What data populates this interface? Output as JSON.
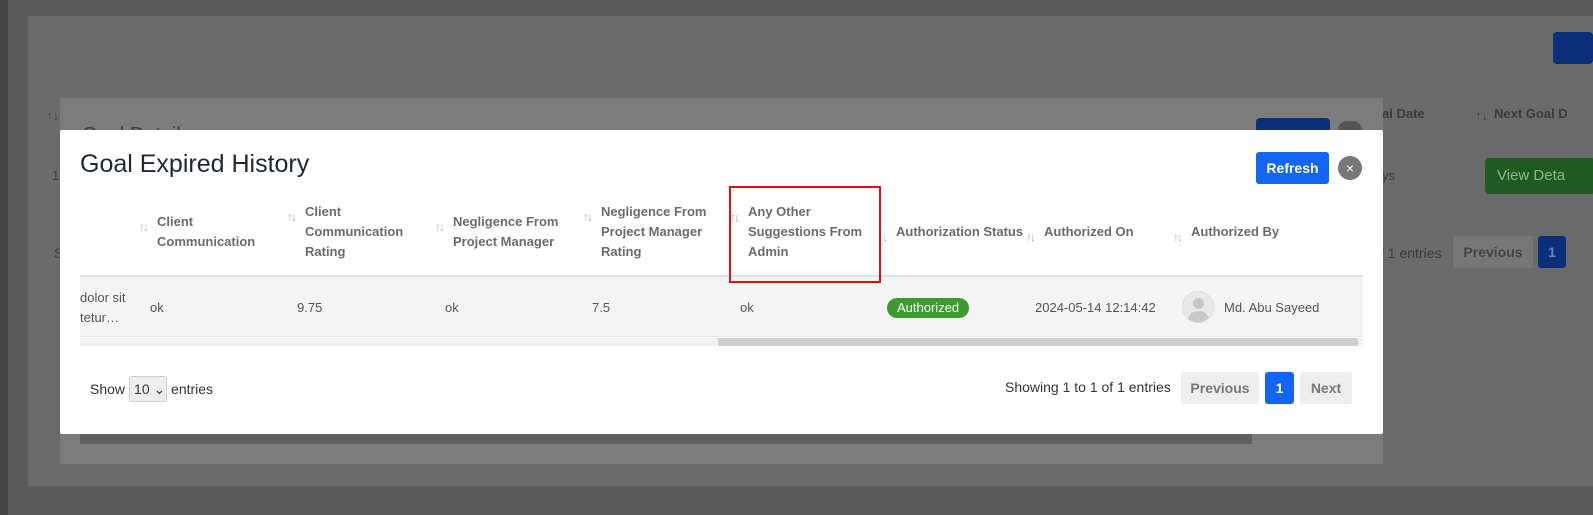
{
  "background": {
    "columns": [
      "al Date",
      "Next Goal D"
    ],
    "row_text": [
      "1",
      "ys"
    ],
    "view_button": "View Deta",
    "side_letter": "S",
    "info": "f 1 entries",
    "previous": "Previous",
    "page": "1"
  },
  "modal": {
    "title": "Goal Expired History",
    "refresh_label": "Refresh",
    "close_glyph": "×",
    "columns": [
      "Client Communication",
      "Client Communication Rating",
      "Negligence From Project Manager",
      "Negligence From Project Manager Rating",
      "Any Other Suggestions From Admin",
      "Authorization Status",
      "Authorized On",
      "Authorized By"
    ],
    "row": {
      "truncated_prev": "dolor sit tetur…",
      "client_communication": "ok",
      "client_communication_rating": "9.75",
      "negligence_pm": "ok",
      "negligence_pm_rating": "7.5",
      "suggestions": "ok",
      "status": "Authorized",
      "authorized_on": "2024-05-14 12:14:42",
      "authorized_by": "Md. Abu Sayeed"
    },
    "footer": {
      "show": "Show",
      "length": "10",
      "entries": "entries",
      "info": "Showing 1 to 1 of 1 entries",
      "previous": "Previous",
      "page": "1",
      "next": "Next"
    }
  },
  "colors": {
    "primary": "#1266f1",
    "authorized": "#3b9b2d",
    "highlight": "#e01010"
  }
}
